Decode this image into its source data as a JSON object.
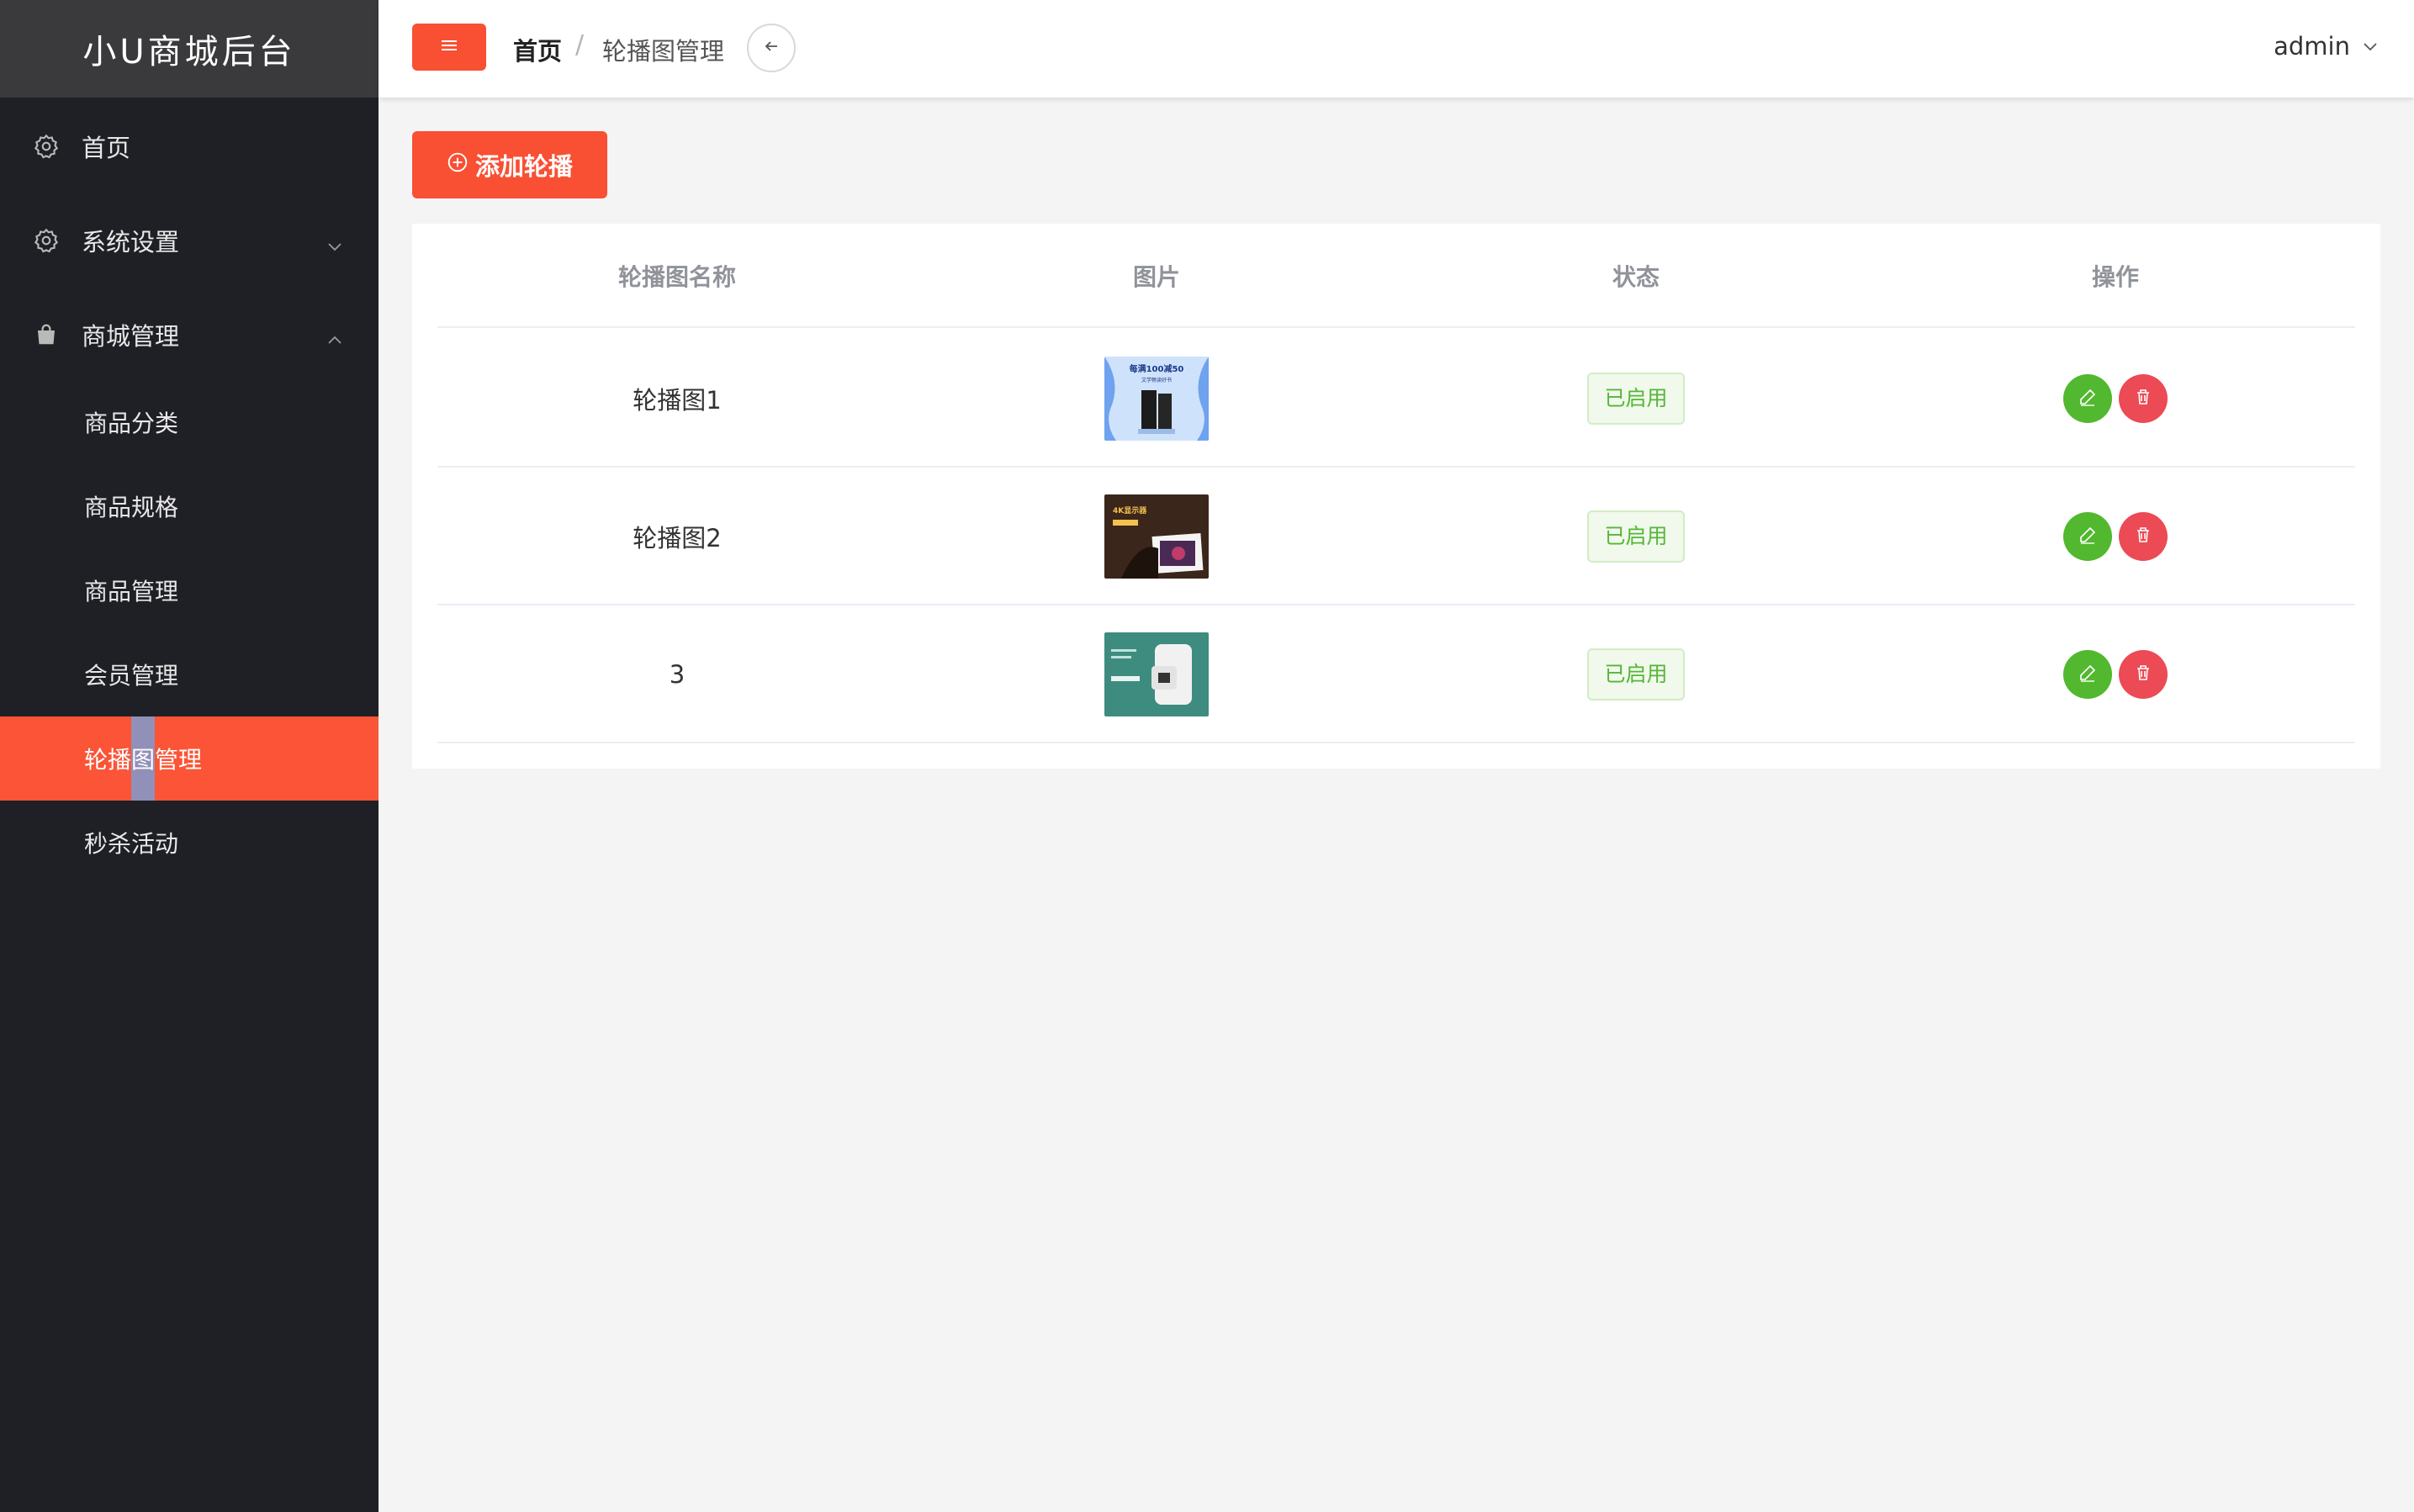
{
  "brand": "小U商城后台",
  "sidebar": {
    "home": "首页",
    "system": "系统设置",
    "mall": "商城管理",
    "sub_items": [
      "商品分类",
      "商品规格",
      "商品管理",
      "会员管理",
      "轮播图管理",
      "秒杀活动"
    ]
  },
  "header": {
    "breadcrumb_home": "首页",
    "breadcrumb_sep": "/",
    "breadcrumb_current": "轮播图管理",
    "user": "admin"
  },
  "actions": {
    "add_label": "添加轮播"
  },
  "table": {
    "columns": [
      "轮播图名称",
      "图片",
      "状态",
      "操作"
    ],
    "rows": [
      {
        "name": "轮播图1",
        "status": "已启用",
        "thumb_text": "每满100减50",
        "thumb_sub": "文学畅读好书"
      },
      {
        "name": "轮播图2",
        "status": "已启用",
        "thumb_text": "4K显示器"
      },
      {
        "name": "3",
        "status": "已启用"
      }
    ]
  },
  "colors": {
    "accent": "#f94f33",
    "sidebar_bg": "#1f2026",
    "edit": "#52b82f",
    "delete": "#ec4a55",
    "tag_green": "#57b53a"
  }
}
